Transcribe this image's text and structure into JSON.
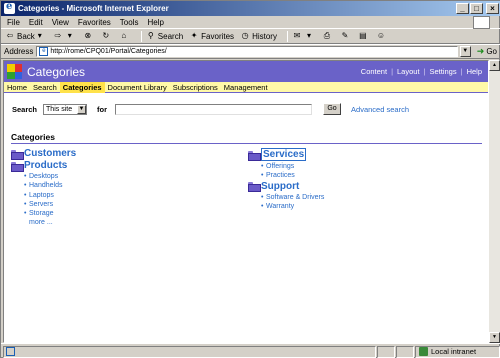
{
  "window": {
    "title": "Categories - Microsoft Internet Explorer",
    "controls": {
      "minimize": "_",
      "maximize": "□",
      "close": "×"
    }
  },
  "menu": [
    "File",
    "Edit",
    "View",
    "Favorites",
    "Tools",
    "Help"
  ],
  "toolbar": {
    "back": "Back",
    "search": "Search",
    "favorites": "Favorites",
    "history": "History"
  },
  "address": {
    "label": "Address",
    "url": "http://rome/CPQ01/Portal/Categories/",
    "go": "Go"
  },
  "portal": {
    "title": "Categories",
    "logo_colors": [
      "#f0d000",
      "#e03030",
      "#30a030",
      "#3060e0"
    ],
    "header_links": [
      "Content",
      "Layout",
      "Settings",
      "Help"
    ],
    "nav": [
      "Home",
      "Search",
      "Categories",
      "Document Library",
      "Subscriptions",
      "Management"
    ],
    "nav_active": "Categories",
    "search": {
      "label": "Search",
      "scope": "This site",
      "for_label": "for",
      "button": "Go",
      "advanced": "Advanced search"
    },
    "section_title": "Categories",
    "left_categories": [
      {
        "name": "Customers",
        "items": []
      },
      {
        "name": "Products",
        "items": [
          "Desktops",
          "Handhelds",
          "Laptops",
          "Servers",
          "Storage"
        ],
        "more": "more ..."
      }
    ],
    "right_categories": [
      {
        "name": "Services",
        "items": [
          "Offerings",
          "Practices"
        ]
      },
      {
        "name": "Support",
        "items": [
          "Software & Drivers",
          "Warranty"
        ]
      }
    ]
  },
  "status": {
    "zone": "Local intranet"
  },
  "colors": {
    "header": "#6a62c8",
    "nav": "#fff9a8",
    "nav_active": "#ffe24a",
    "link": "#2a6cc8"
  }
}
